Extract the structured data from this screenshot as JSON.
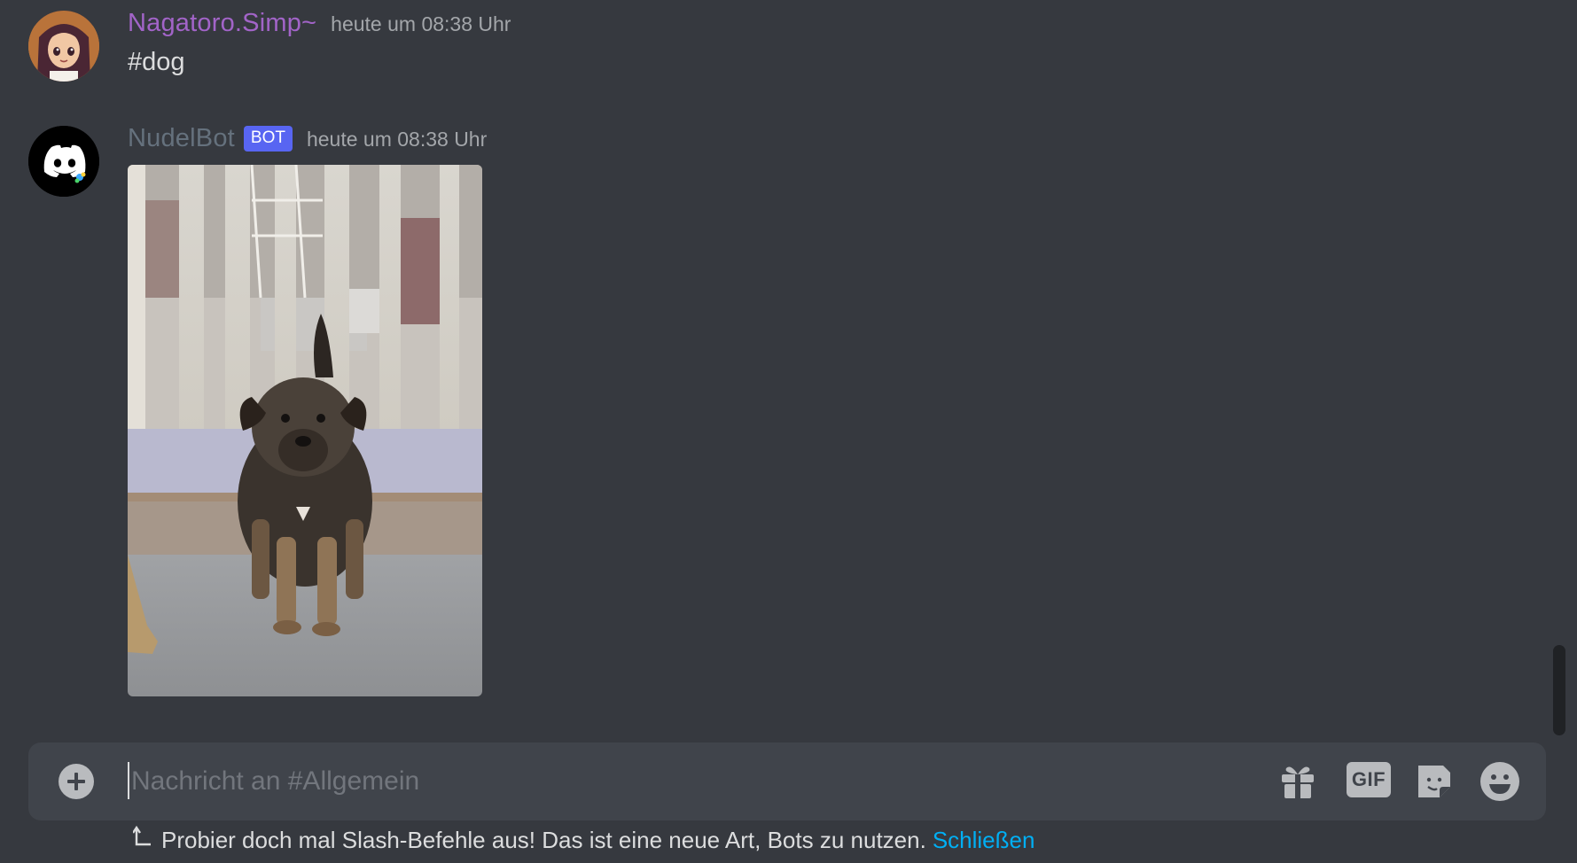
{
  "messages": [
    {
      "username": "Nagatoro.Simp~",
      "username_color": "#a264c8",
      "timestamp": "heute um 08:38 Uhr",
      "text": "#dog",
      "avatar": "anime-girl-avatar"
    },
    {
      "username": "NudelBot",
      "username_color": "#65717d",
      "bot_tag": "BOT",
      "timestamp": "heute um 08:38 Uhr",
      "attachment": "dog-photo",
      "avatar": "discord-logo-avatar"
    }
  ],
  "composer": {
    "placeholder": "Nachricht an #Allgemein",
    "attach_icon": "plus-circle-icon",
    "gift_icon": "gift-icon",
    "gif_label": "GIF",
    "sticker_icon": "sticker-icon",
    "emoji_icon": "emoji-icon"
  },
  "hint": {
    "text": "Probier doch mal Slash-Befehle aus! Das ist eine neue Art, Bots zu nutzen.",
    "link": "Schließen",
    "link_color": "#00aff4"
  },
  "colors": {
    "background": "#36393f",
    "composer": "#40444b",
    "bot_tag": "#5865f2"
  }
}
